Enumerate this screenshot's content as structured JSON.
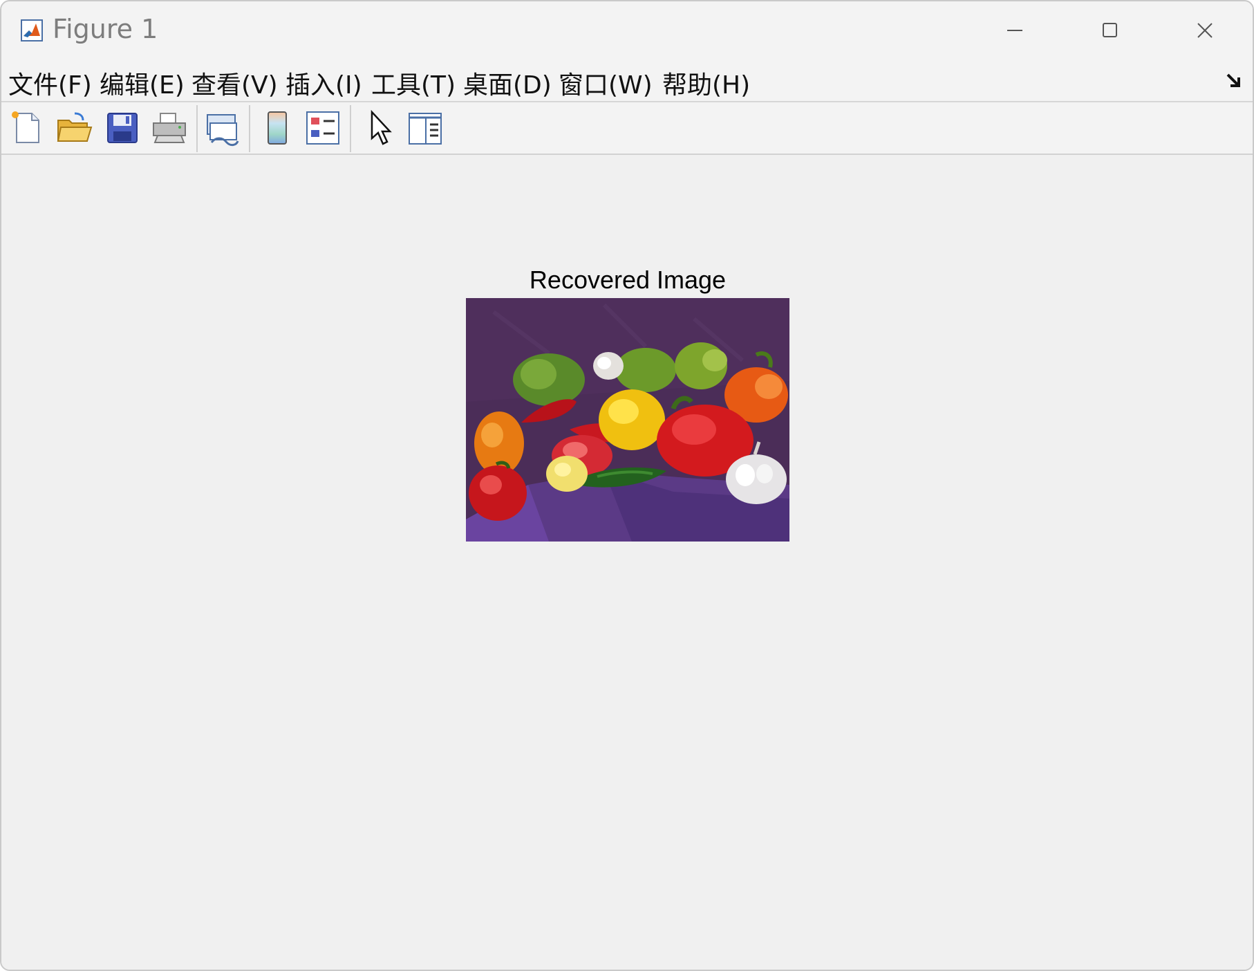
{
  "window": {
    "title": "Figure 1"
  },
  "menu": [
    {
      "label": "文件(F)"
    },
    {
      "label": "编辑(E)"
    },
    {
      "label": "查看(V)"
    },
    {
      "label": "插入(I)"
    },
    {
      "label": "工具(T)"
    },
    {
      "label": "桌面(D)"
    },
    {
      "label": "窗口(W)"
    },
    {
      "label": "帮助(H)"
    }
  ],
  "toolbar": [
    {
      "icon": "new-figure-icon"
    },
    {
      "icon": "open-folder-icon"
    },
    {
      "icon": "save-icon"
    },
    {
      "icon": "print-icon"
    },
    {
      "icon": "link-plot-icon"
    },
    {
      "icon": "colorbar-icon"
    },
    {
      "icon": "legend-icon"
    },
    {
      "icon": "edit-plot-pointer-icon"
    },
    {
      "icon": "property-inspector-icon"
    }
  ],
  "figure": {
    "axes_title": "Recovered Image",
    "image_subject": "peppers-image"
  },
  "colors": {
    "window_bg": "#f0f0f0",
    "title_text": "#7d7d7d",
    "menu_text": "#111111",
    "axes_title": "#000000"
  }
}
